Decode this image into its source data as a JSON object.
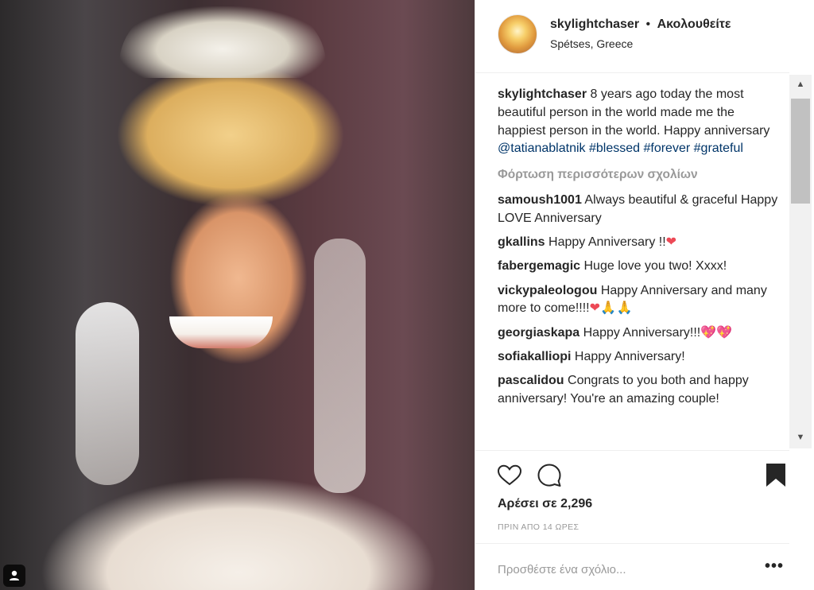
{
  "post": {
    "username": "skylightchaser",
    "separator": "•",
    "follow_label": "Ακολουθείτε",
    "location": "Spétses, Greece",
    "caption": {
      "username": "skylightchaser",
      "text": "8 years ago today the most beautiful person in the world made me the happiest person in the world. Happy anniversary",
      "mention": "@tatianablatnik",
      "hashtags": [
        "#blessed",
        "#forever",
        "#grateful"
      ]
    },
    "load_more_label": "Φόρτωση περισσότερων σχολίων",
    "comments": [
      {
        "username": "samoush1001",
        "text": "Always beautiful & graceful Happy LOVE Anniversary",
        "emoji": ""
      },
      {
        "username": "gkallins",
        "text": "Happy Anniversary !!",
        "emoji": "❤"
      },
      {
        "username": "fabergemagic",
        "text": "Huge love you two! Xxxx!",
        "emoji": ""
      },
      {
        "username": "vickypaleologou",
        "text": "Happy Anniversary and many more to come!!!!",
        "emoji": "❤",
        "emoji2": "🙏🙏"
      },
      {
        "username": "georgiaskapa",
        "text": "Happy Anniversary!!!",
        "emoji": "💖💖"
      },
      {
        "username": "sofiakalliopi",
        "text": "Happy Anniversary!",
        "emoji": ""
      },
      {
        "username": "pascalidou",
        "text": "Congrats to you both and happy anniversary! You're an amazing couple!",
        "emoji": ""
      }
    ],
    "likes_prefix": "Αρέσει σε",
    "likes_count": "2,296",
    "time_ago": "ΠΡΙΝ ΑΠΟ 14 ΩΡΕΣ",
    "comment_placeholder": "Προσθέστε ένα σχόλιο...",
    "more_label": "•••"
  },
  "icons": {
    "like": "heart-outline-icon",
    "comment": "speech-bubble-icon",
    "bookmark": "bookmark-filled-icon",
    "multi_photo": "user-tag-icon"
  },
  "colors": {
    "text": "#262626",
    "muted": "#999999",
    "link": "#003569",
    "heart": "#ed4956",
    "border": "#efefef"
  }
}
